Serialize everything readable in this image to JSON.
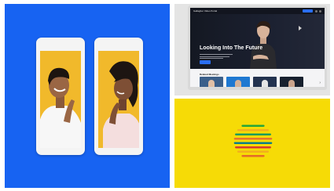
{
  "laptop_app": {
    "brand": "Gallagher Video Portal",
    "signin_label": "",
    "hero_title": "Looking Into The Future",
    "section_title": "Related Meetings",
    "next_arrow": "›"
  },
  "colors": {
    "blue_tile": "#1763f2",
    "phone_screen": "#f1b92b",
    "yellow_tile": "#f6db06",
    "accent_blue": "#2a6ef2",
    "hero_dark": "#141822"
  },
  "logo_stripes": [
    "#26a639",
    "#f2b01d",
    "#1a9c5b",
    "#e8742c",
    "#0c7f88",
    "#d93a2b",
    "#f2b01d",
    "#e46a2b"
  ]
}
